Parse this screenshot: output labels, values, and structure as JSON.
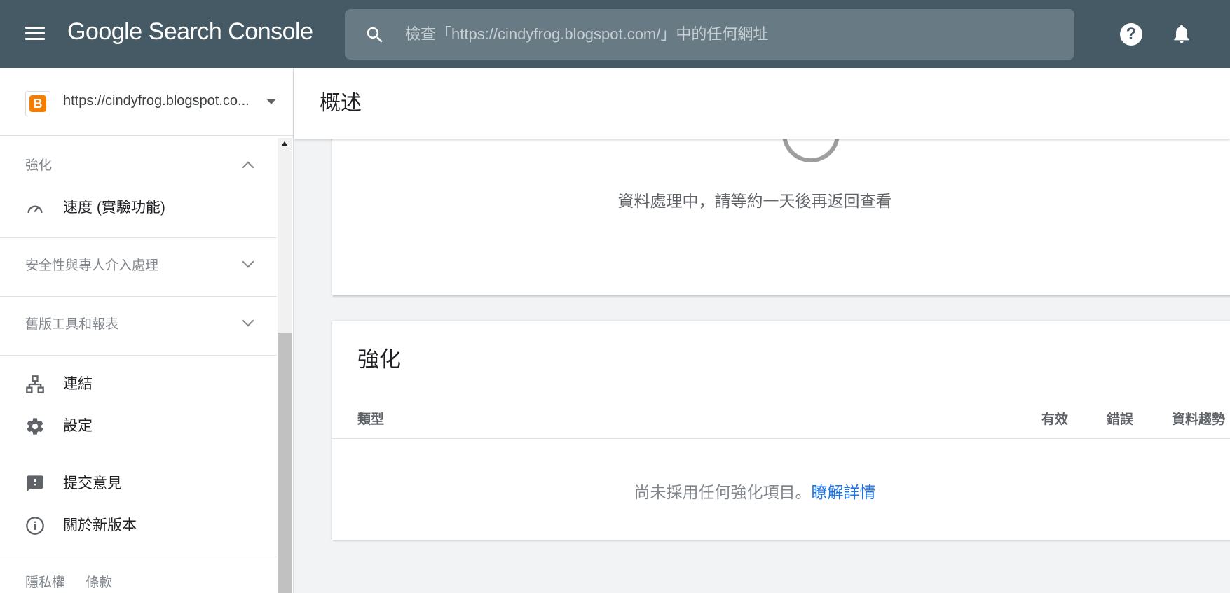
{
  "header": {
    "app_title": "Google Search Console",
    "search_placeholder": "檢查「https://cindyfrog.blogspot.com/」中的任何網址"
  },
  "sidebar": {
    "property_url": "https://cindyfrog.blogspot.co...",
    "sections": [
      {
        "label": "強化",
        "expanded": true
      },
      {
        "label": "安全性與專人介入處理",
        "expanded": false
      },
      {
        "label": "舊版工具和報表",
        "expanded": false
      }
    ],
    "items": {
      "speed": "速度 (實驗功能)",
      "links": "連結",
      "settings": "設定",
      "feedback": "提交意見",
      "about": "關於新版本"
    },
    "footer": {
      "privacy": "隱私權",
      "terms": "條款"
    }
  },
  "main": {
    "page_title": "概述",
    "processing_message": "資料處理中，請等約一天後再返回查看",
    "enhancements_card": {
      "title": "強化",
      "columns": [
        "類型",
        "有效",
        "錯誤",
        "資料趨勢"
      ],
      "empty_text": "尚未採用任何強化項目。",
      "learn_more": "瞭解詳情"
    }
  },
  "colors": {
    "header_bg": "#455a64",
    "search_bg": "#687b85",
    "link_blue": "#1a73e8",
    "blogger_orange": "#f57d00"
  }
}
